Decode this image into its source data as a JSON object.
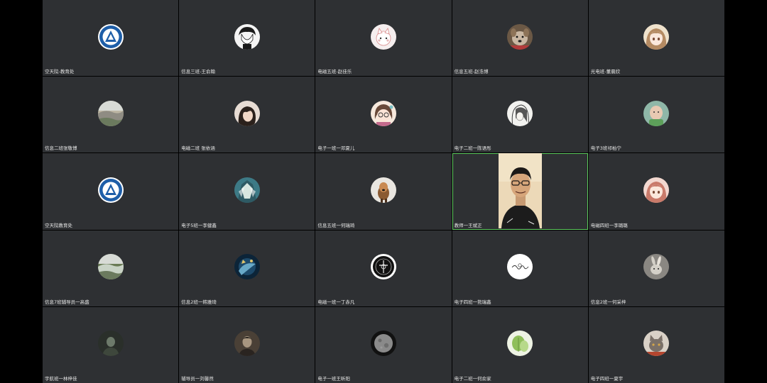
{
  "meeting": {
    "accent_color": "#5ecb5e",
    "tile_color": "#2e3033",
    "participants": [
      {
        "name": "空天院-教育处",
        "avatar": "school-logo-icon",
        "colors": [
          "#ffffff",
          "#1e5ea8"
        ]
      },
      {
        "name": "信息三班-王俞翰",
        "avatar": "anime-boy-avatar-icon",
        "colors": [
          "#f4f4f4",
          "#1a1a1a"
        ]
      },
      {
        "name": "电磁五班-赵佳乐",
        "avatar": "cartoon-cat-avatar-icon",
        "colors": [
          "#f5eeee",
          "#d98a8a"
        ]
      },
      {
        "name": "信息五班-赵浩博",
        "avatar": "dog-avatar-icon",
        "colors": [
          "#c9b7a3",
          "#6b5845"
        ]
      },
      {
        "name": "光电班-董晨欣",
        "avatar": "anime-girl-avatar-icon",
        "colors": [
          "#efe2cc",
          "#b48a62"
        ]
      },
      {
        "name": "信息二班张敬博",
        "avatar": "landscape-avatar-icon",
        "colors": [
          "#8f8c83",
          "#bdb6a4"
        ]
      },
      {
        "name": "电磁二班 张依涵",
        "avatar": "girl-photo-avatar-icon",
        "colors": [
          "#e7dcd4",
          "#2b211c"
        ]
      },
      {
        "name": "电子一班一邓夏儿",
        "avatar": "cartoon-glasses-girl-icon",
        "colors": [
          "#f7e9dd",
          "#c46a8c"
        ]
      },
      {
        "name": "电子二班一陈语彤",
        "avatar": "sketch-girl-avatar-icon",
        "colors": [
          "#f2f2ef",
          "#3b3b3b"
        ]
      },
      {
        "name": "电子3班祁柏宁",
        "avatar": "baby-avatar-icon",
        "colors": [
          "#8fb7a8",
          "#e8c9b2"
        ]
      },
      {
        "name": "空天院教育处",
        "avatar": "school-logo-icon",
        "colors": [
          "#ffffff",
          "#1e5ea8"
        ]
      },
      {
        "name": "电子5班一李健鑫",
        "avatar": "anime-character-avatar-icon",
        "colors": [
          "#3d7a86",
          "#d8e6e0"
        ]
      },
      {
        "name": "信息五班一何瑞琦",
        "avatar": "dog-photo-avatar-icon",
        "colors": [
          "#e9e6e0",
          "#8a5a32"
        ]
      },
      {
        "name": "教师一王斌正",
        "avatar": "video-feed-icon",
        "video": true,
        "colors": [
          "#ecd9b8",
          "#1c1c1c"
        ]
      },
      {
        "name": "电磁四班一李璐璐",
        "avatar": "anime-girl-avatar-icon",
        "colors": [
          "#f3d8d0",
          "#c97a6a"
        ]
      },
      {
        "name": "信息7班辅导员一高盛",
        "avatar": "landscape-avatar-icon",
        "colors": [
          "#c9d3c6",
          "#6a7b55"
        ]
      },
      {
        "name": "信息2班一韩雅琦",
        "avatar": "underwater-avatar-icon",
        "colors": [
          "#1d4a6b",
          "#68a9c8"
        ]
      },
      {
        "name": "电磁一班一丁赤凡",
        "avatar": "emblem-avatar-icon",
        "colors": [
          "#111111",
          "#f0f0f0"
        ]
      },
      {
        "name": "电子四班一熊瑞鑫",
        "avatar": "signature-avatar-icon",
        "colors": [
          "#ffffff",
          "#333333"
        ]
      },
      {
        "name": "信息2班一何采梓",
        "avatar": "rabbit-avatar-icon",
        "colors": [
          "#8a8782",
          "#d4d0c8"
        ]
      },
      {
        "name": "宇航班一林梓佳",
        "avatar": "dark-portrait-avatar-icon",
        "colors": [
          "#2a2f2a",
          "#6d7a6a"
        ]
      },
      {
        "name": "辅导员一刘馨然",
        "avatar": "portrait-avatar-icon",
        "colors": [
          "#4a4036",
          "#a89680"
        ]
      },
      {
        "name": "电子一班王昕阳",
        "avatar": "moon-avatar-icon",
        "colors": [
          "#111111",
          "#8a8a8a"
        ]
      },
      {
        "name": "电子二班一何俞家",
        "avatar": "plant-avatar-icon",
        "colors": [
          "#eef3e4",
          "#8fbf5a"
        ]
      },
      {
        "name": "电子四班一夏宇",
        "avatar": "cat-avatar-icon",
        "colors": [
          "#d9d1c7",
          "#7a7068"
        ]
      }
    ]
  }
}
